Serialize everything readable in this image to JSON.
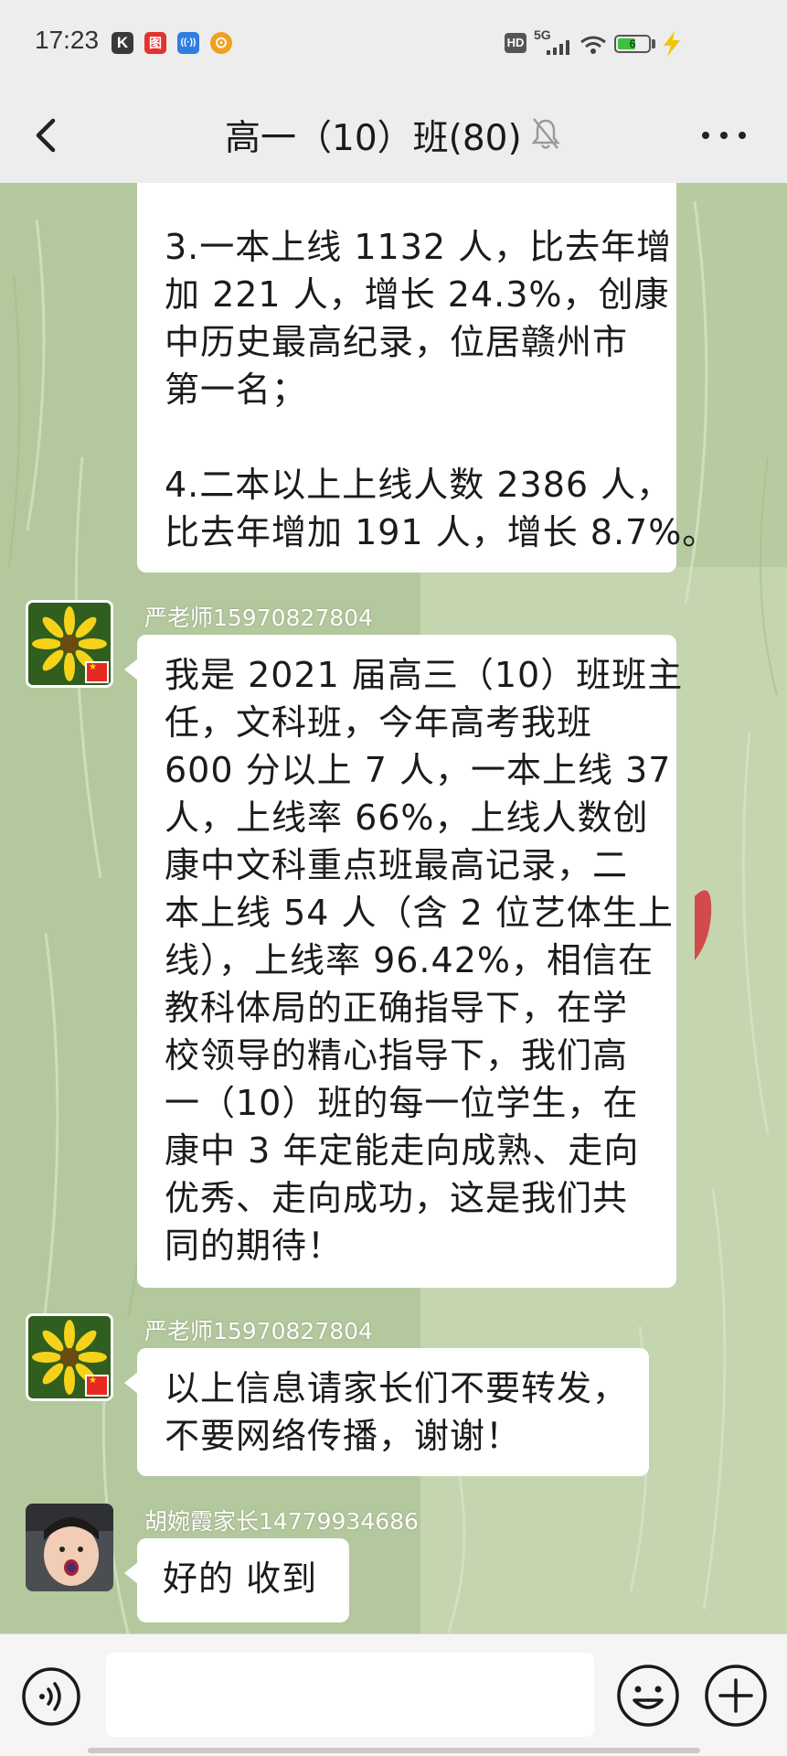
{
  "status_bar": {
    "time": "17:23",
    "app_icons": [
      "K",
      "图",
      "((·))",
      "⊙"
    ],
    "hd": "HD",
    "network": "5G",
    "battery_level": 0.6,
    "battery_text": "6"
  },
  "header": {
    "title": "高一（10）班(80)",
    "back_icon": "chevron-left-icon",
    "mute_icon": "bell-muted-icon",
    "more_icon": "more-dots-icon"
  },
  "messages": [
    {
      "sender": "",
      "lines": [
        "3.一本上线 1132 人，比去年增",
        "加 221 人，增长 24.3%，创康",
        "中历史最高纪录，位居赣州市",
        "第一名；",
        "",
        "4.二本以上上线人数 2386 人，",
        "比去年增加 191 人，增长 8.7%。"
      ]
    },
    {
      "sender": "严老师15970827804",
      "lines": [
        "我是 2021 届高三（10）班班主",
        "任，文科班，今年高考我班",
        "600 分以上 7 人，一本上线 37",
        "人，上线率 66%，上线人数创",
        "康中文科重点班最高记录，二",
        "本上线 54 人（含 2 位艺体生上",
        "线），上线率 96.42%，相信在",
        "教科体局的正确指导下，在学",
        "校领导的精心指导下，我们高",
        "一（10）班的每一位学生，在",
        "康中 3 年定能走向成熟、走向",
        "优秀、走向成功，这是我们共",
        "同的期待！"
      ]
    },
    {
      "sender": "严老师15970827804",
      "lines": [
        "以上信息请家长们不要转发，",
        "不要网络传播，谢谢！"
      ]
    },
    {
      "sender": "胡婉霞家长14779934686",
      "lines": [
        "好的 收到"
      ]
    }
  ],
  "input_bar": {
    "voice_icon": "voice-icon",
    "input_value": "",
    "emoji_icon": "emoji-icon",
    "plus_icon": "plus-icon"
  },
  "colors": {
    "chat_bg": "#b9cda4",
    "bubble": "#ffffff",
    "bar_bg": "#ededed"
  }
}
